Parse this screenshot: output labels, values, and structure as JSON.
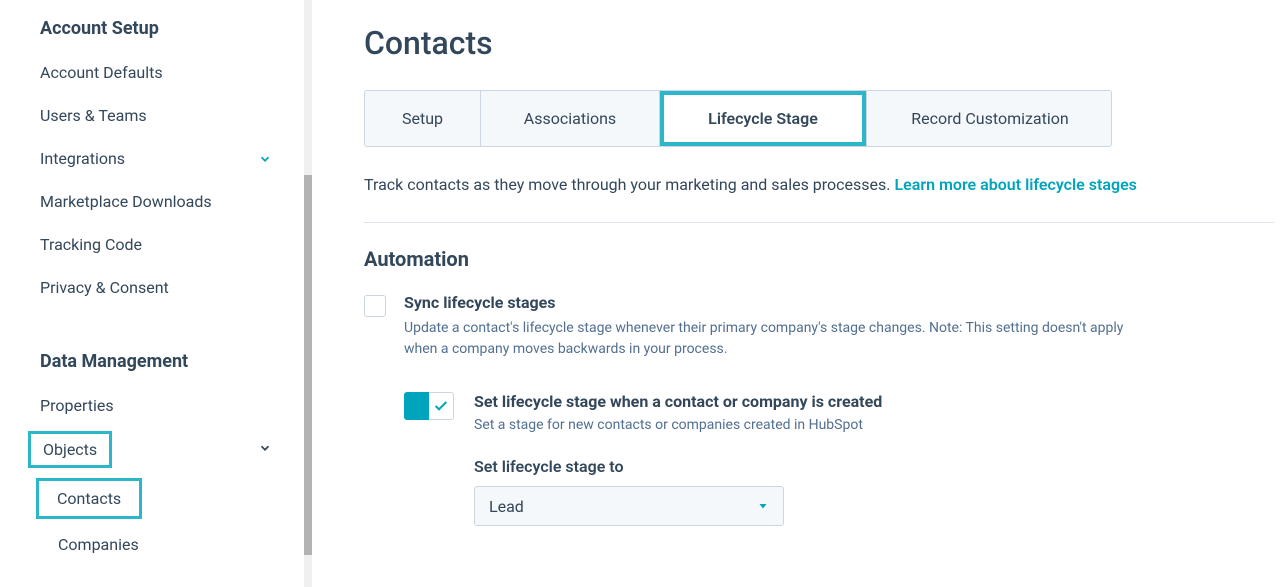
{
  "sidebar": {
    "section1_title": "Account Setup",
    "items1": [
      "Account Defaults",
      "Users & Teams",
      "Integrations",
      "Marketplace Downloads",
      "Tracking Code",
      "Privacy & Consent"
    ],
    "section2_title": "Data Management",
    "properties_label": "Properties",
    "objects_label": "Objects",
    "contacts_label": "Contacts",
    "companies_label": "Companies"
  },
  "main": {
    "page_title": "Contacts",
    "tabs": {
      "setup": "Setup",
      "associations": "Associations",
      "lifecycle": "Lifecycle Stage",
      "record": "Record Customization"
    },
    "desc_text": "Track contacts as they move through your marketing and sales processes. ",
    "desc_link": "Learn more about lifecycle stages",
    "automation_title": "Automation",
    "sync": {
      "label": "Sync lifecycle stages",
      "sub": "Update a contact's lifecycle stage whenever their primary company's stage changes. Note: This setting doesn't apply when a company moves backwards in your process."
    },
    "set_created": {
      "label": "Set lifecycle stage when a contact or company is created",
      "sub": "Set a stage for new contacts or companies created in HubSpot"
    },
    "select": {
      "label": "Set lifecycle stage to",
      "value": "Lead"
    }
  }
}
